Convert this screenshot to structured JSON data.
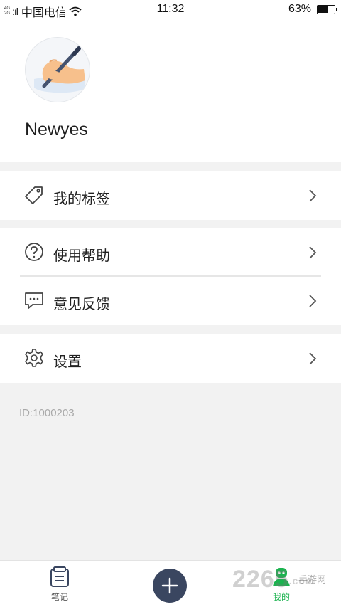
{
  "status_bar": {
    "network_top": "4G",
    "network_bottom": "2G",
    "carrier": "中国电信",
    "time": "11:32",
    "battery_percent": "63%",
    "battery_level": 0.63
  },
  "profile": {
    "username": "Newyes",
    "avatar_icon": "pen-hand-avatar"
  },
  "menu": {
    "tags_label": "我的标签",
    "help_label": "使用帮助",
    "feedback_label": "意见反馈",
    "settings_label": "设置"
  },
  "user_id": "ID:1000203",
  "tab_bar": {
    "notes_label": "笔记",
    "add_icon": "plus-icon",
    "mine_label": "我的",
    "active_color": "#1bb34f"
  },
  "watermark": {
    "text": "2265",
    "suffix": ".com",
    "sub": "手游网"
  }
}
